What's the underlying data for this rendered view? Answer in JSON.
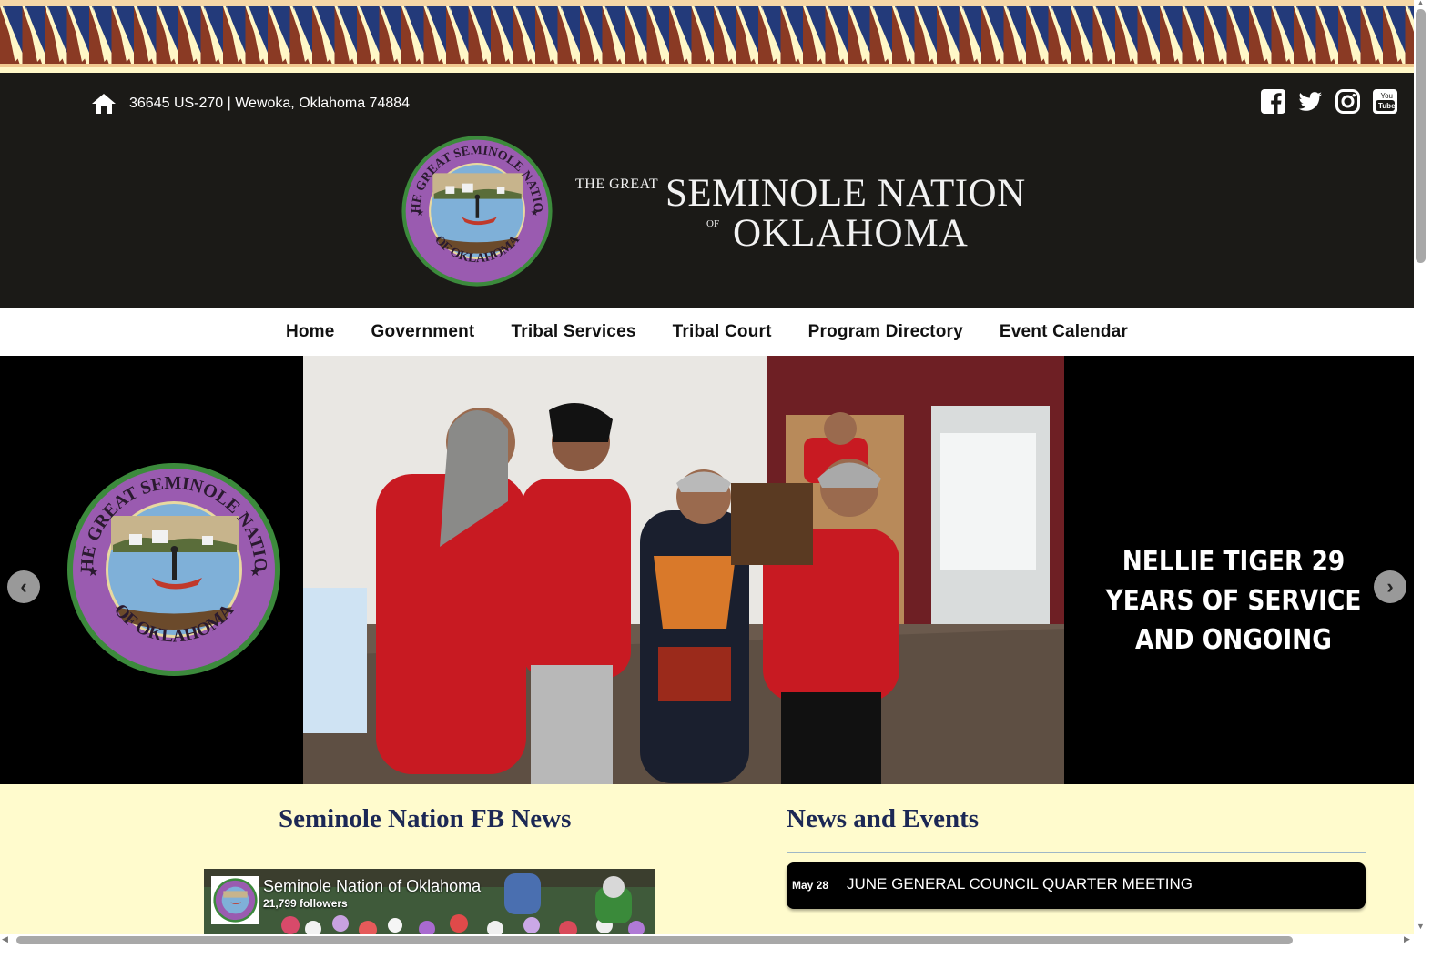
{
  "header": {
    "address": "36645 US-270 | Wewoka, Oklahoma 74884",
    "title_the_great": "THE GREAT",
    "title_main": "SEMINOLE NATION",
    "title_of": "OF",
    "title_oklahoma": "OKLAHOMA",
    "social_icons": [
      "facebook-icon",
      "twitter-icon",
      "instagram-icon",
      "youtube-icon"
    ],
    "seal_text_top": "THE GREAT SEMINOLE NATION",
    "seal_text_bottom": "OF OKLAHOMA"
  },
  "nav": {
    "items": [
      "Home",
      "Government",
      "Tribal Services",
      "Tribal Court",
      "Program Directory",
      "Event Calendar"
    ]
  },
  "slider": {
    "caption": "NELLIE TIGER 29 YEARS OF SERVICE AND ONGOING",
    "prev_glyph": "‹",
    "next_glyph": "›"
  },
  "fb_news": {
    "heading": "Seminole Nation FB News",
    "page_name": "Seminole Nation of Oklahoma",
    "followers": "21,799 followers"
  },
  "news_events": {
    "heading": "News and Events",
    "items": [
      {
        "date": "May 28",
        "title": "JUNE GENERAL COUNCIL QUARTER MEETING"
      }
    ]
  },
  "colors": {
    "header_bg": "#1b1a17",
    "heading_navy": "#1c2855",
    "content_bg": "#fffbcd",
    "seal_purple": "#9a5bb0",
    "seal_green": "#3c8a3c",
    "band_navy": "#233a7a",
    "band_brown": "#8a3a24"
  }
}
